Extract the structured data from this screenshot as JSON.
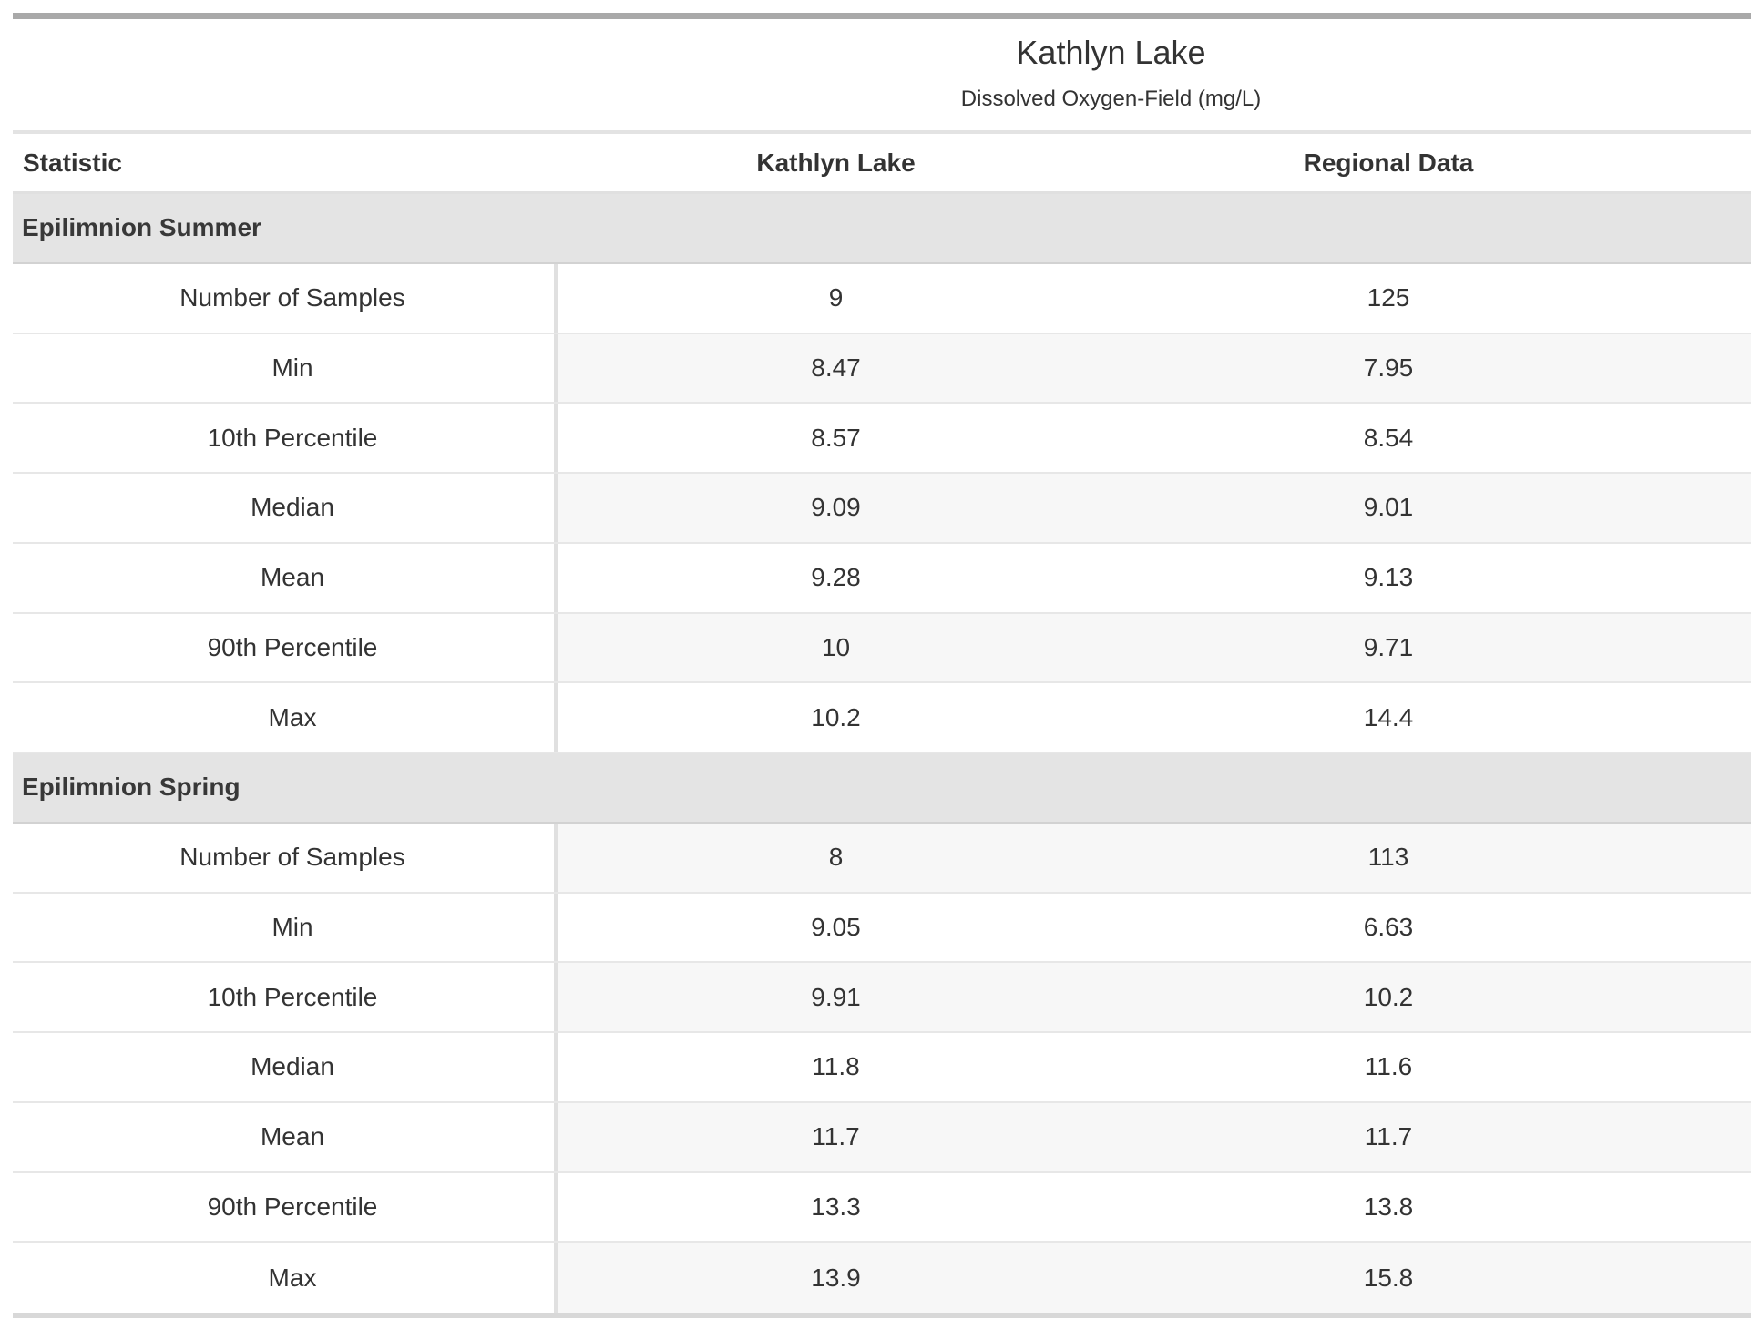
{
  "page": {
    "title": "Kathlyn Lake",
    "subtitle": "Dissolved Oxygen-Field (mg/L)"
  },
  "table": {
    "columns": {
      "statistic": "Statistic",
      "lake": "Kathlyn Lake",
      "regional": "Regional Data"
    },
    "sections": [
      {
        "label": "Epilimnion Summer",
        "rows": [
          {
            "stat": "Number of Samples",
            "lake": "9",
            "regional": "125"
          },
          {
            "stat": "Min",
            "lake": "8.47",
            "regional": "7.95"
          },
          {
            "stat": "10th Percentile",
            "lake": "8.57",
            "regional": "8.54"
          },
          {
            "stat": "Median",
            "lake": "9.09",
            "regional": "9.01"
          },
          {
            "stat": "Mean",
            "lake": "9.28",
            "regional": "9.13"
          },
          {
            "stat": "90th Percentile",
            "lake": "10",
            "regional": "9.71"
          },
          {
            "stat": "Max",
            "lake": "10.2",
            "regional": "14.4"
          }
        ]
      },
      {
        "label": "Epilimnion Spring",
        "rows": [
          {
            "stat": "Number of Samples",
            "lake": "8",
            "regional": "113"
          },
          {
            "stat": "Min",
            "lake": "9.05",
            "regional": "6.63"
          },
          {
            "stat": "10th Percentile",
            "lake": "9.91",
            "regional": "10.2"
          },
          {
            "stat": "Median",
            "lake": "11.8",
            "regional": "11.6"
          },
          {
            "stat": "Mean",
            "lake": "11.7",
            "regional": "11.7"
          },
          {
            "stat": "90th Percentile",
            "lake": "13.3",
            "regional": "13.8"
          },
          {
            "stat": "Max",
            "lake": "13.9",
            "regional": "15.8"
          }
        ]
      }
    ]
  },
  "colors": {
    "top_bar": "#a9a9a9",
    "section_header_bg": "#e4e4e4",
    "stripe_bg": "#f7f7f7",
    "text": "#333333"
  }
}
